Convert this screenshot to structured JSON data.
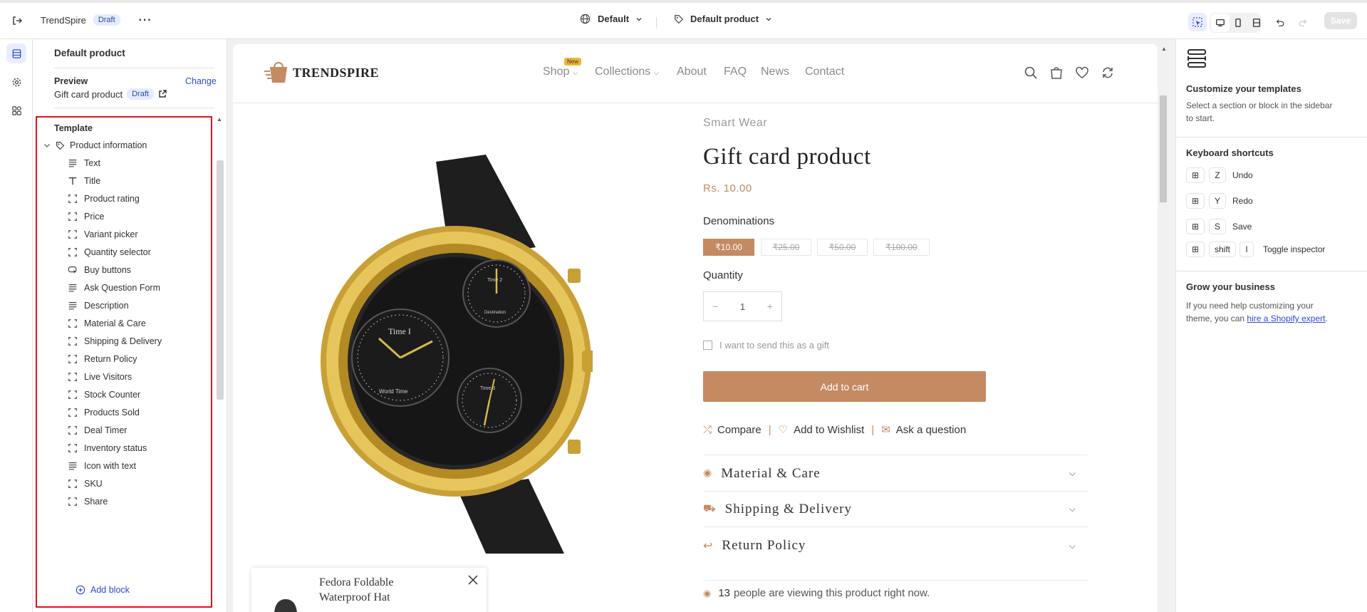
{
  "topbar": {
    "store_name": "TrendSpire",
    "status": "Draft",
    "theme_select": "Default",
    "template_select": "Default product",
    "save_label": "Save"
  },
  "sidebar": {
    "title": "Default product",
    "preview_label": "Preview",
    "change_label": "Change",
    "preview_item": "Gift card product",
    "preview_status": "Draft",
    "template_label": "Template",
    "section_name": "Product information",
    "blocks": [
      {
        "label": "Text",
        "icon": "text-lines-icon"
      },
      {
        "label": "Title",
        "icon": "title-t-icon"
      },
      {
        "label": "Product rating",
        "icon": "block-frame-icon"
      },
      {
        "label": "Price",
        "icon": "block-frame-icon"
      },
      {
        "label": "Variant picker",
        "icon": "block-frame-icon"
      },
      {
        "label": "Quantity selector",
        "icon": "block-frame-icon"
      },
      {
        "label": "Buy buttons",
        "icon": "buy-button-icon"
      },
      {
        "label": "Ask Question Form",
        "icon": "text-lines-icon"
      },
      {
        "label": "Description",
        "icon": "text-lines-icon"
      },
      {
        "label": "Material & Care",
        "icon": "block-frame-icon"
      },
      {
        "label": "Shipping & Delivery",
        "icon": "block-frame-icon"
      },
      {
        "label": "Return Policy",
        "icon": "block-frame-icon"
      },
      {
        "label": "Live Visitors",
        "icon": "block-frame-icon"
      },
      {
        "label": "Stock Counter",
        "icon": "block-frame-icon"
      },
      {
        "label": "Products Sold",
        "icon": "block-frame-icon"
      },
      {
        "label": "Deal Timer",
        "icon": "block-frame-icon"
      },
      {
        "label": "Inventory status",
        "icon": "block-frame-icon"
      },
      {
        "label": "Icon with text",
        "icon": "text-lines-icon"
      },
      {
        "label": "SKU",
        "icon": "block-frame-icon"
      },
      {
        "label": "Share",
        "icon": "block-frame-icon"
      }
    ],
    "add_block_label": "Add block"
  },
  "store": {
    "brand": "TRENDSPIRE",
    "nav": [
      "Shop",
      "Collections",
      "About",
      "FAQ",
      "News",
      "Contact"
    ],
    "new_badge": "New",
    "vendor": "Smart Wear",
    "product_title": "Gift card product",
    "price": "Rs. 10.00",
    "denominations_label": "Denominations",
    "denominations": [
      "₹10.00",
      "₹25.00",
      "₹50.00",
      "₹100.00"
    ],
    "quantity_label": "Quantity",
    "quantity_value": "1",
    "gift_checkbox_label": "I want to send this as a gift",
    "add_to_cart_label": "Add to cart",
    "compare_label": "Compare",
    "wishlist_label": "Add to Wishlist",
    "ask_label": "Ask a question",
    "accordions": [
      "Material & Care",
      "Shipping & Delivery",
      "Return Policy"
    ],
    "viewers_count": "13",
    "viewers_text": "people are viewing this product right now.",
    "popup_product": "Fedora Foldable Waterproof Hat",
    "watch_labels": {
      "dial1": "Time I",
      "dial2": "Time 2",
      "dial3": "Time 3",
      "world": "World Time",
      "dest": "Destination"
    }
  },
  "rightpane": {
    "customize_title": "Customize your templates",
    "customize_text": "Select a section or block in the sidebar to start.",
    "shortcuts_title": "Keyboard shortcuts",
    "shortcuts": [
      {
        "key": "Z",
        "label": "Undo"
      },
      {
        "key": "Y",
        "label": "Redo"
      },
      {
        "key": "S",
        "label": "Save"
      }
    ],
    "inspector_key1": "shift",
    "inspector_key2": "I",
    "inspector_label": "Toggle inspector",
    "grow_title": "Grow your business",
    "grow_text": "If you need help customizing your theme, you can",
    "grow_link": "hire a Shopify expert",
    "grow_end": "."
  },
  "colors": {
    "accent_brown": "#c48a62",
    "highlight_red": "#e8121c",
    "link_blue": "#2c6ecb"
  }
}
